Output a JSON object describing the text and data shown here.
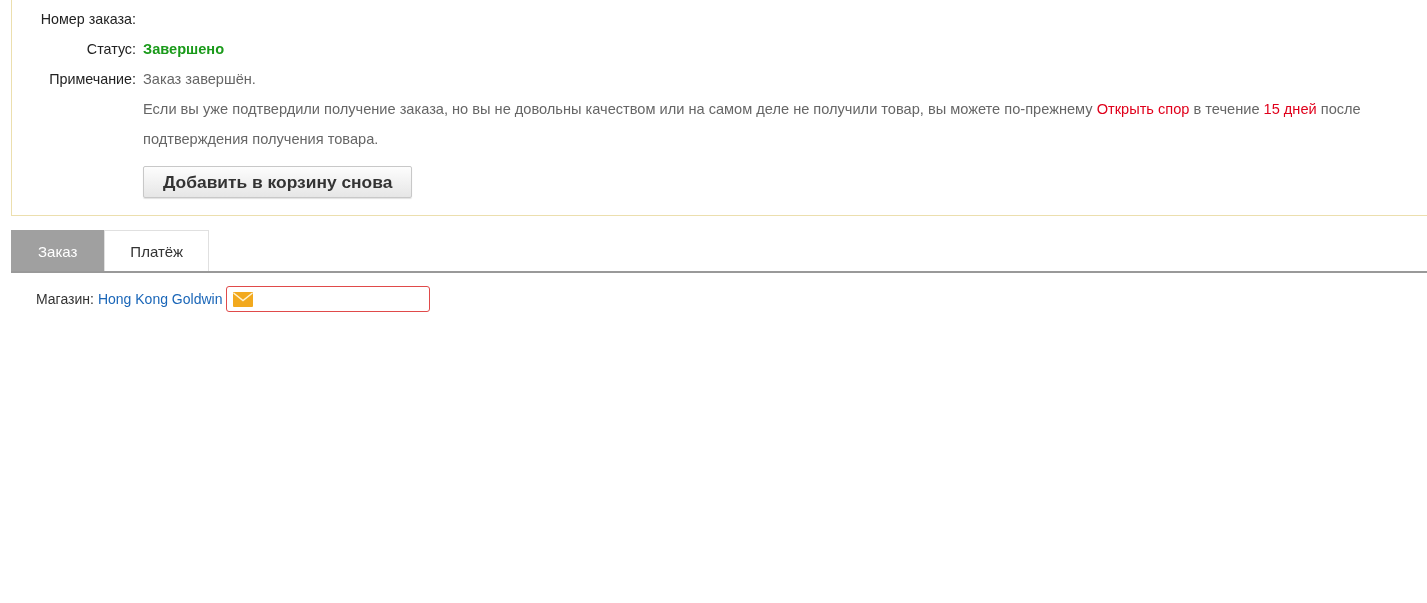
{
  "order_info": {
    "fields": [
      {
        "kind": "order_number",
        "label": "Номер заказа:"
      },
      {
        "kind": "status",
        "label": "Статус:",
        "value": "Завершено"
      },
      {
        "kind": "note",
        "label": "Примечание:",
        "value": "Заказ завершён."
      }
    ],
    "note_detail": [
      {
        "kind": "plain",
        "text": "Если вы уже подтвердили получение заказа, но вы не довольны качеством или на самом деле не получили товар, вы можете по-прежнему "
      },
      {
        "kind": "link",
        "text": "Открыть спор"
      },
      {
        "kind": "plain",
        "text": " в течение "
      },
      {
        "kind": "highlight",
        "text": "15 дней"
      },
      {
        "kind": "plain",
        "text": " после подтверждения получения товара."
      }
    ],
    "reorder_button": "Добавить в корзину снова"
  },
  "tabs": [
    {
      "label": "Заказ",
      "selected": true
    },
    {
      "label": "Платёж",
      "selected": false
    }
  ],
  "store": {
    "label": "Магазин:",
    "name": "Hong Kong Goldwin"
  }
}
